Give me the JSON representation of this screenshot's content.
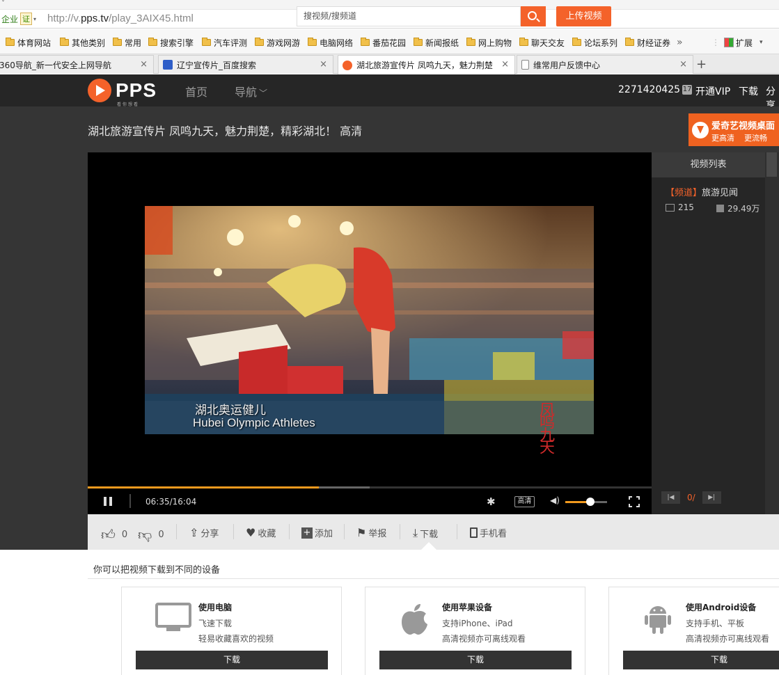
{
  "browser": {
    "enterprise_label": "企业",
    "cert_badge": "证",
    "url_prefix": "http://v.",
    "url_domain": "pps.tv",
    "url_path": "/play_3AIX45.html",
    "bookmarks": [
      "体育网站",
      "其他类别",
      "常用",
      "搜索引擎",
      "汽车评测",
      "游戏网游",
      "电脑网络",
      "番茄花园",
      "新闻报纸",
      "网上购物",
      "聊天交友",
      "论坛系列",
      "财经证券"
    ],
    "bookmarks_more": "»",
    "extend_label": "扩展",
    "tabs": [
      {
        "label": "360导航_新一代安全上网导航"
      },
      {
        "label": "辽宁宣传片_百度搜索"
      },
      {
        "label": "湖北旅游宣传片 凤鸣九天，魅力荆楚"
      },
      {
        "label": "维常用户反馈中心"
      }
    ],
    "new_tab": "+"
  },
  "header": {
    "logo_text": "PPS",
    "logo_sub": "看你想看",
    "nav": [
      "首页",
      "导航"
    ],
    "search_placeholder": "搜视频/搜频道",
    "upload_label": "上传视频",
    "user_id": "2271420425",
    "user_level": "17",
    "vip_label": "开通VIP",
    "download_label": "下载",
    "share_label": "分享"
  },
  "page": {
    "title": "湖北旅游宣传片 凤鸣九天，魅力荆楚，精彩湖北！ 高清",
    "promo_line1": "爱奇艺视频桌面",
    "promo_line2a": "更高清",
    "promo_line2b": "更流畅"
  },
  "player": {
    "caption_cn": "湖北奥运健儿",
    "caption_en": "Hubei Olympic Athletes",
    "watermark": "凤鸣九天",
    "time": "06:35/16:04",
    "progress": 0.41,
    "volume": 0.6,
    "quality_label": "高清"
  },
  "sidebar": {
    "title": "视频列表",
    "channel_tag": "【频道】",
    "channel_name": "旅游见闻",
    "video_count": "215",
    "play_count": "29.49万",
    "page": "0/"
  },
  "toolbar": {
    "like_count": "0",
    "dislike_count": "0",
    "share": "分享",
    "collect": "收藏",
    "add": "添加",
    "report": "举报",
    "download": "下载",
    "mobile": "手机看"
  },
  "download": {
    "heading": "你可以把视频下载到不同的设备",
    "cards": [
      {
        "title": "使用电脑",
        "line1": "飞速下载",
        "line2": "轻易收藏喜欢的视频",
        "button": "下载"
      },
      {
        "title": "使用苹果设备",
        "line1": "支持iPhone、iPad",
        "line2": "高清视频亦可离线观看",
        "button": "下载"
      },
      {
        "title": "使用Android设备",
        "line1": "支持手机、平板",
        "line2": "高清视频亦可离线观看",
        "button": "下载"
      }
    ]
  }
}
